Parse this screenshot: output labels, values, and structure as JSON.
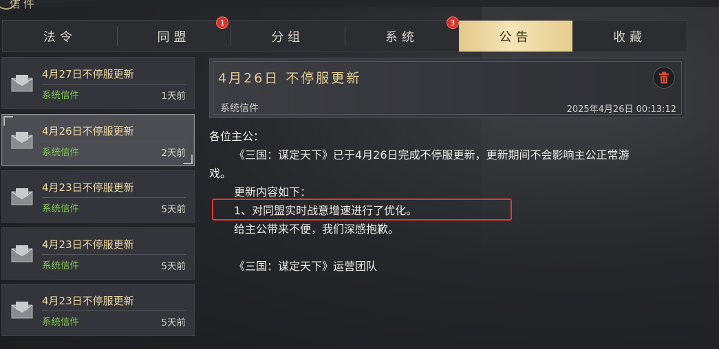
{
  "window": {
    "title": "信件"
  },
  "tabs": [
    {
      "label": "法令",
      "badge": ""
    },
    {
      "label": "同盟",
      "badge": "1"
    },
    {
      "label": "分组",
      "badge": ""
    },
    {
      "label": "系统",
      "badge": "3"
    },
    {
      "label": "公告",
      "badge": "",
      "active": true
    },
    {
      "label": "收藏",
      "badge": ""
    }
  ],
  "mails": [
    {
      "title": "4月27日不停服更新",
      "sender": "系统信件",
      "time": "1天前"
    },
    {
      "title": "4月26日不停服更新",
      "sender": "系统信件",
      "time": "2天前",
      "selected": true
    },
    {
      "title": "4月23日不停服更新",
      "sender": "系统信件",
      "time": "5天前"
    },
    {
      "title": "4月23日不停服更新",
      "sender": "系统信件",
      "time": "5天前"
    },
    {
      "title": "4月23日不停服更新",
      "sender": "系统信件",
      "time": "5天前"
    }
  ],
  "detail": {
    "title": "4月26日 不停服更新",
    "sender": "系统信件",
    "date": "2025年4月26日 00:13:12",
    "greeting": "各位主公：",
    "para1": "《三国：谋定天下》已于4月26日完成不停服更新，更新期间不会影响主公正常游",
    "para1_cont": "戏。",
    "update_heading": "更新内容如下：",
    "update_item": "1、对同盟实时战意增速进行了优化。",
    "apology": "给主公带来不便，我们深感抱歉。",
    "signature": "《三国：谋定天下》运营团队"
  },
  "colors": {
    "accent_gold": "#e4ce95",
    "sender_green": "#7fc454",
    "badge_red": "#d8322c",
    "highlight_red": "#e53935"
  },
  "icons": {
    "mail": "envelope-icon",
    "delete": "trash-icon"
  }
}
